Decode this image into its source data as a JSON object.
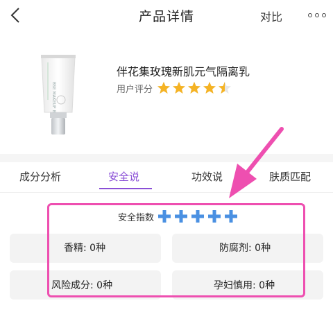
{
  "header": {
    "title": "产品详情",
    "compare_label": "对比",
    "back_icon": "chevron-left-icon",
    "more_icon": "more-horizontal-icon"
  },
  "product": {
    "name": "伴花集玫瑰新肌元气隔离乳",
    "rating_label": "用户评分",
    "rating": 4.5,
    "rating_max": 5,
    "image_lettering": "BSE MAKEUP BSE",
    "star_color": "#f5b324"
  },
  "tabs": [
    {
      "label": "成分分析",
      "active": false
    },
    {
      "label": "安全说",
      "active": true
    },
    {
      "label": "功效说",
      "active": false
    },
    {
      "label": "肤质匹配",
      "active": false
    }
  ],
  "safety": {
    "label": "安全指数",
    "score": 5,
    "score_max": 5,
    "cross_color": "#4a90e2"
  },
  "stats": {
    "fragrance": "香精: 0种",
    "preservative": "防腐剂: 0种",
    "risk": "风险成分: 0种",
    "pregnancy": "孕妇慎用: 0种"
  },
  "colors": {
    "accent": "#8a4fd6",
    "annotation": "#ee4fb0"
  }
}
